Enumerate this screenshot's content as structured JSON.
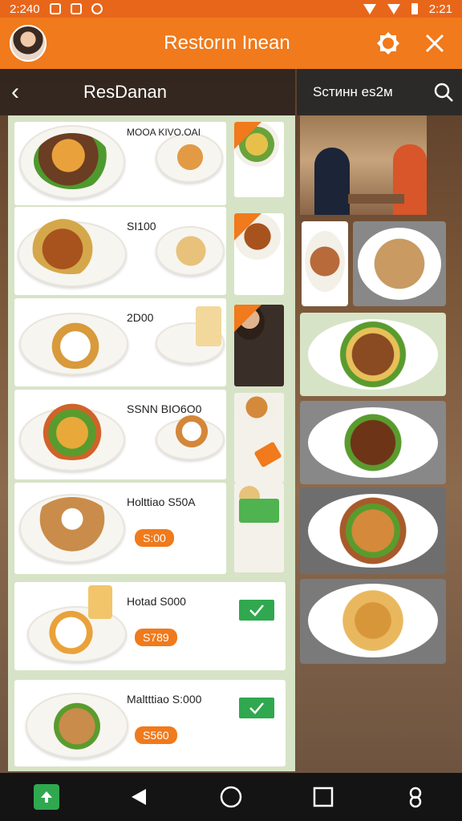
{
  "status_bar": {
    "time": "2:240",
    "right_time": "2:21"
  },
  "header": {
    "title": "Restorın Inean"
  },
  "left_panel": {
    "title": "ResDanan"
  },
  "search": {
    "label": "Sстинн еѕ2м"
  },
  "menu_items": [
    {
      "name": "MOOA KIVO.OAI",
      "price": "",
      "checked": false
    },
    {
      "name": "SI100",
      "price": "",
      "checked": false
    },
    {
      "name": "2D00",
      "price": "",
      "checked": false
    },
    {
      "name": "SSNN BIO6O0",
      "price": "",
      "checked": false
    },
    {
      "name": "Holttiao S50A",
      "price": "S:00",
      "checked": false
    },
    {
      "name": "Hotad S000",
      "price": "S789",
      "checked": true
    },
    {
      "name": "Maltttiao S:000",
      "price": "S560",
      "checked": true
    }
  ],
  "colors": {
    "accent": "#f07a1c",
    "check": "#2fa84f",
    "panel": "#d7e3c6"
  },
  "icons": {
    "header": [
      "avatar",
      "settings-icon",
      "close-icon"
    ],
    "nav": [
      "up-arrow-icon",
      "back-triangle-icon",
      "home-circle-icon",
      "recents-square-icon",
      "assistant-icon"
    ]
  }
}
